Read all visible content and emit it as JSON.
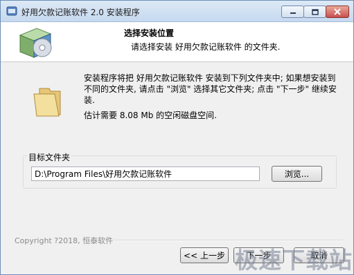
{
  "window": {
    "title": "好用欠款记账软件 2.0 安装程序"
  },
  "header": {
    "title": "选择安装位置",
    "subtitle": "请选择安装 好用欠款记账软件 的文件夹."
  },
  "body": {
    "description": "安装程序将把 好用欠款记账软件 安装到下列文件夹中; 如果想安装到不同的文件夹, 请点击 \"浏览\" 选择其它文件夹; 点击 \"下一步\" 继续安装.",
    "space_required": "估计需要 8.08 Mb 的空闲磁盘空间."
  },
  "target": {
    "label": "目标文件夹",
    "path": "D:\\Program Files\\好用欠款记账软件",
    "browse_label": "浏览..."
  },
  "footer": {
    "copyright": "Copyright  ?2018, 恒泰软件",
    "back_label": "<< 上一步",
    "next_label": "下一步",
    "cancel_label": "取消"
  },
  "watermark": "极速下载站"
}
